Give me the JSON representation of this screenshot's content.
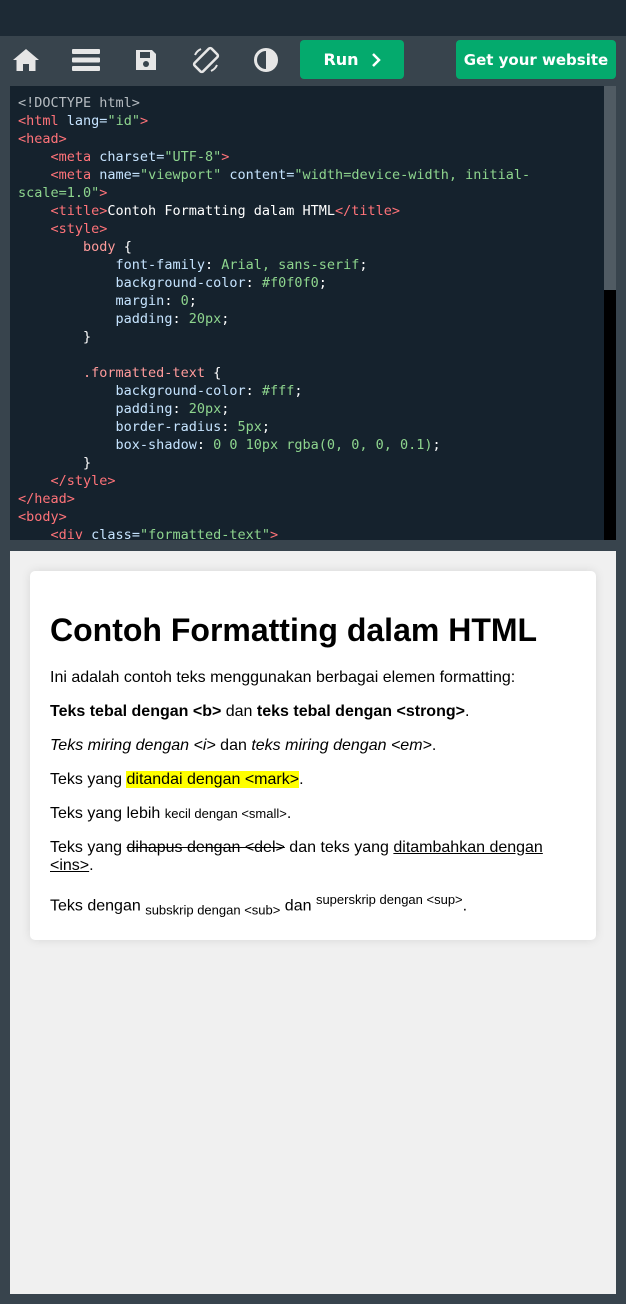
{
  "toolbar": {
    "run_label": "Run",
    "website_label": "Get your website"
  },
  "icons": [
    "home-icon",
    "menu-icon",
    "save-icon",
    "rotate-icon",
    "contrast-icon",
    "chevron-right-icon"
  ],
  "colors": {
    "accent": "#04aa6d",
    "editor_bg": "#15222d",
    "topbar": "#1d2a35",
    "toolbar": "#38444d"
  },
  "code": {
    "l1": "<!DOCTYPE html>",
    "l2_tag": "<html",
    "l2_attr": "lang",
    "l2_eq": "=",
    "l2_val": "\"id\"",
    "l2_end": ">",
    "l3": "<head>",
    "l4_tag": "<meta",
    "l4_attr": "charset",
    "l4_val": "\"UTF-8\"",
    "l4_end": ">",
    "l5_tag": "<meta",
    "l5_attr1": "name",
    "l5_val1": "\"viewport\"",
    "l5_attr2": "content",
    "l5_val2a": "\"width=device-width, initial-",
    "l6_val2b": "scale=1.0\"",
    "l6_end": ">",
    "l7_open": "<title>",
    "l7_text": "Contoh Formatting dalam HTML",
    "l7_close": "</title>",
    "l8": "<style>",
    "l9_sel": "body",
    "l9_brace": "{",
    "l10_prop": "font-family",
    "l10_val": "Arial, sans-serif",
    "l11_prop": "background-color",
    "l11_val": "#f0f0f0",
    "l12_prop": "margin",
    "l12_val": "0",
    "l13_prop": "padding",
    "l13_val": "20px",
    "l14_brace": "}",
    "l16_sel": ".formatted-text",
    "l16_brace": "{",
    "l17_prop": "background-color",
    "l17_val": "#fff",
    "l18_prop": "padding",
    "l18_val": "20px",
    "l19_prop": "border-radius",
    "l19_val": "5px",
    "l20_prop": "box-shadow",
    "l20_val": "0 0 10px rgba(0, 0, 0, 0.1)",
    "l21_brace": "}",
    "l22": "</style>",
    "l23": "</head>",
    "l24": "<body>",
    "l25_tag": "<div",
    "l25_attr": "class",
    "l25_val": "\"formatted-text\"",
    "l25_end": ">"
  },
  "preview": {
    "heading": "Contoh Formatting dalam HTML",
    "p1": "Ini adalah contoh teks menggunakan berbagai elemen formatting:",
    "p2_b": "Teks tebal dengan <b>",
    "p2_mid": " dan ",
    "p2_strong": "teks tebal dengan <strong>",
    "p2_end": ".",
    "p3_i": "Teks miring dengan <i>",
    "p3_mid": " dan ",
    "p3_em": "teks miring dengan <em>",
    "p3_end": ".",
    "p4_pre": "Teks yang ",
    "p4_mark": "ditandai dengan <mark>",
    "p4_end": ".",
    "p5_pre": "Teks yang lebih ",
    "p5_small": "kecil dengan <small>",
    "p5_end": ".",
    "p6_pre": "Teks yang ",
    "p6_del": "dihapus dengan <del>",
    "p6_mid": " dan teks yang ",
    "p6_ins": "ditambahkan dengan <ins>",
    "p6_end": ".",
    "p7_pre": "Teks dengan ",
    "p7_sub": "subskrip dengan <sub>",
    "p7_mid": " dan ",
    "p7_sup": "superskrip dengan <sup>",
    "p7_end": "."
  }
}
